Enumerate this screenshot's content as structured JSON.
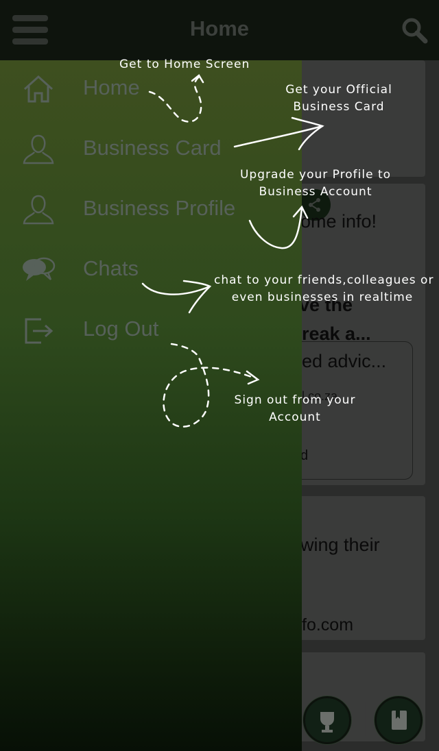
{
  "header": {
    "title": "Home"
  },
  "drawer": {
    "items": [
      {
        "label": "Home",
        "icon": "home-icon"
      },
      {
        "label": "Business Card",
        "icon": "user-icon"
      },
      {
        "label": "Business Profile",
        "icon": "user-icon"
      },
      {
        "label": "Chats",
        "icon": "chat-bubbles-icon"
      },
      {
        "label": "Log Out",
        "icon": "logout-icon"
      }
    ]
  },
  "background": {
    "peek_line1": "ome info!",
    "peek_line2": "ve the",
    "peek_line3": "reak a...",
    "peek_line4": "ed advic...",
    "peek_line5": "l.co.za",
    "peek_line6": "d",
    "peek_line7": "wing their",
    "peek_line8": "fo.com"
  },
  "annotations": {
    "home": "Get to Home Screen",
    "business_card_1": "Get your Official",
    "business_card_2": "Business Card",
    "business_profile_1": "Upgrade your Profile to",
    "business_profile_2": "Business Account",
    "chats_1": "chat to your friends,colleagues or",
    "chats_2": "even businesses in realtime",
    "logout_1": "Sign out from your",
    "logout_2": "Account"
  },
  "colors": {
    "drawer_top": "#3e4f1f",
    "drawer_bottom": "#071006",
    "header": "#0e140d"
  }
}
